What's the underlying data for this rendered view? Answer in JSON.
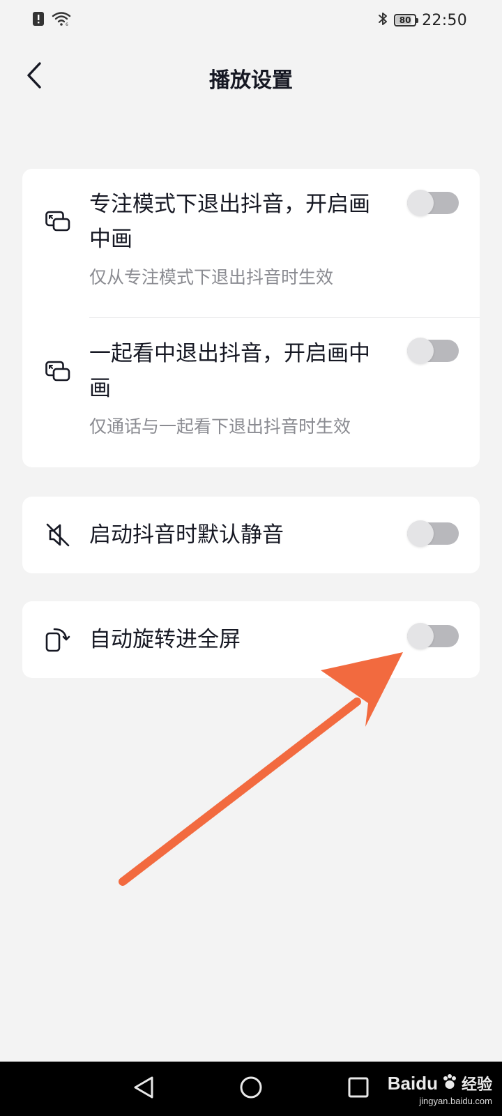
{
  "status_bar": {
    "battery": "80",
    "time": "22:50",
    "icons": [
      "alert-icon",
      "wifi-icon",
      "bluetooth-icon",
      "battery-icon"
    ]
  },
  "header": {
    "title": "播放设置",
    "back_icon": "chevron-left-icon"
  },
  "settings": {
    "pip_focus": {
      "title": "专注模式下退出抖音，开启画中画",
      "subtitle": "仅从专注模式下退出抖音时生效",
      "enabled": false,
      "icon": "pip-icon"
    },
    "pip_watch_together": {
      "title": "一起看中退出抖音，开启画中画",
      "subtitle": "仅通话与一起看下退出抖音时生效",
      "enabled": false,
      "icon": "pip-icon"
    },
    "default_mute": {
      "title": "启动抖音时默认静音",
      "enabled": false,
      "icon": "mute-icon"
    },
    "auto_rotate": {
      "title": "自动旋转进全屏",
      "enabled": false,
      "icon": "rotate-screen-icon"
    }
  },
  "colors": {
    "background": "#f3f3f3",
    "card": "#ffffff",
    "toggle_off": "#b8b8bc",
    "annotation_arrow": "#f26a3f"
  },
  "nav_bar": {
    "icons": [
      "back-triangle-icon",
      "home-circle-icon",
      "recents-square-icon"
    ]
  },
  "watermark": {
    "brand": "Baidu",
    "brand_cn": "经验",
    "url": "jingyan.baidu.com"
  }
}
